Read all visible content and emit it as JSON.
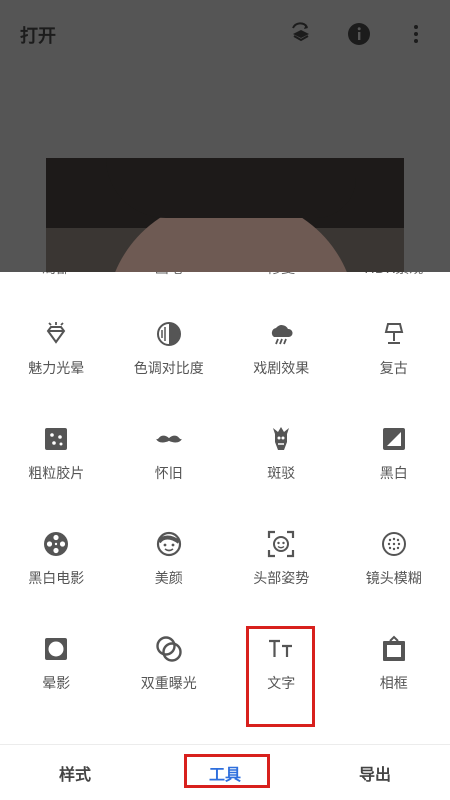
{
  "header": {
    "title": "打开",
    "icons": [
      "layers-rotate-icon",
      "info-icon",
      "more-vertical-icon"
    ]
  },
  "cut_row": [
    "局部",
    "画笔",
    "修复",
    "HDR景观"
  ],
  "tools": [
    [
      {
        "label": "魅力光晕",
        "icon": "glamour-glow-icon"
      },
      {
        "label": "色调对比度",
        "icon": "tonal-contrast-icon"
      },
      {
        "label": "戏剧效果",
        "icon": "drama-icon"
      },
      {
        "label": "复古",
        "icon": "vintage-lamp-icon"
      }
    ],
    [
      {
        "label": "粗粒胶片",
        "icon": "grainy-film-icon"
      },
      {
        "label": "怀旧",
        "icon": "mustache-icon"
      },
      {
        "label": "斑驳",
        "icon": "grunge-icon"
      },
      {
        "label": "黑白",
        "icon": "black-white-icon"
      }
    ],
    [
      {
        "label": "黑白电影",
        "icon": "film-reel-icon"
      },
      {
        "label": "美颜",
        "icon": "face-icon"
      },
      {
        "label": "头部姿势",
        "icon": "head-pose-icon"
      },
      {
        "label": "镜头模糊",
        "icon": "lens-blur-icon"
      }
    ],
    [
      {
        "label": "晕影",
        "icon": "vignette-icon"
      },
      {
        "label": "双重曝光",
        "icon": "double-exposure-icon"
      },
      {
        "label": "文字",
        "icon": "text-icon"
      },
      {
        "label": "相框",
        "icon": "frame-icon"
      }
    ]
  ],
  "nav": {
    "items": [
      "样式",
      "工具",
      "导出"
    ],
    "active": "工具"
  },
  "colors": {
    "accent": "#2f6fdd",
    "highlight": "#d8201d",
    "overlay": "#555555"
  }
}
